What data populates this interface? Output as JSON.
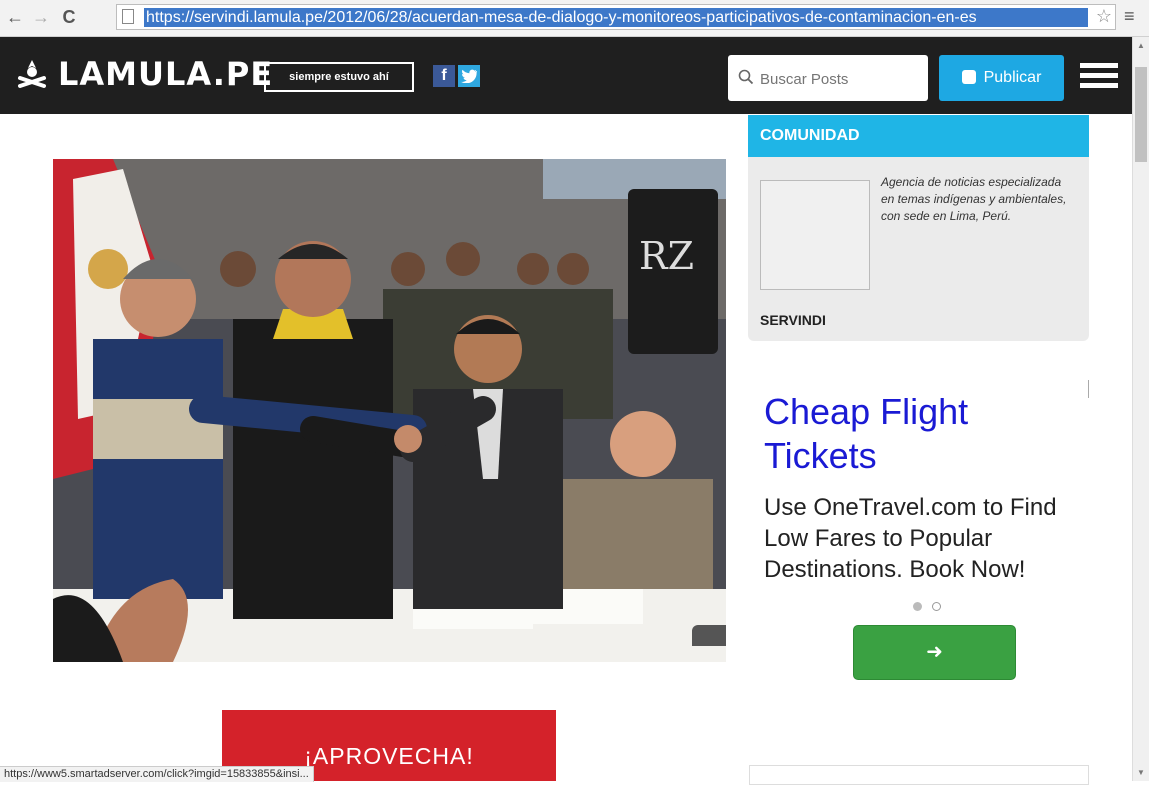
{
  "browser": {
    "url": "https://servindi.lamula.pe/2012/06/28/acuerdan-mesa-de-dialogo-y-monitoreos-participativos-de-contaminacion-en-es",
    "status_url": "https://www5.smartadserver.com/click?imgid=15833855&insi..."
  },
  "header": {
    "logo_text": "LAMULA.PE",
    "tagline": "siempre estuvo ahí",
    "facebook_label": "f",
    "search_placeholder": "Buscar Posts",
    "publish_label": "Publicar"
  },
  "sidebar": {
    "community_title": "COMUNIDAD",
    "community_description": "Agencia de noticias especializada en temas indígenas y ambientales, con sede en Lima, Perú.",
    "community_name": "SERVINDI"
  },
  "ad": {
    "title": "Cheap Flight Tickets",
    "body": "Use OneTravel.com to Find Low Fares to Popular Destinations. Book Now!",
    "button_label": "➜"
  },
  "promo": {
    "text": "¡APROVECHA!"
  },
  "colors": {
    "header_bg": "#1f1f1f",
    "accent": "#1ea8e3",
    "ad_title": "#1a1ad4",
    "ad_button": "#3aa142",
    "promo_bg": "#d4222a"
  }
}
